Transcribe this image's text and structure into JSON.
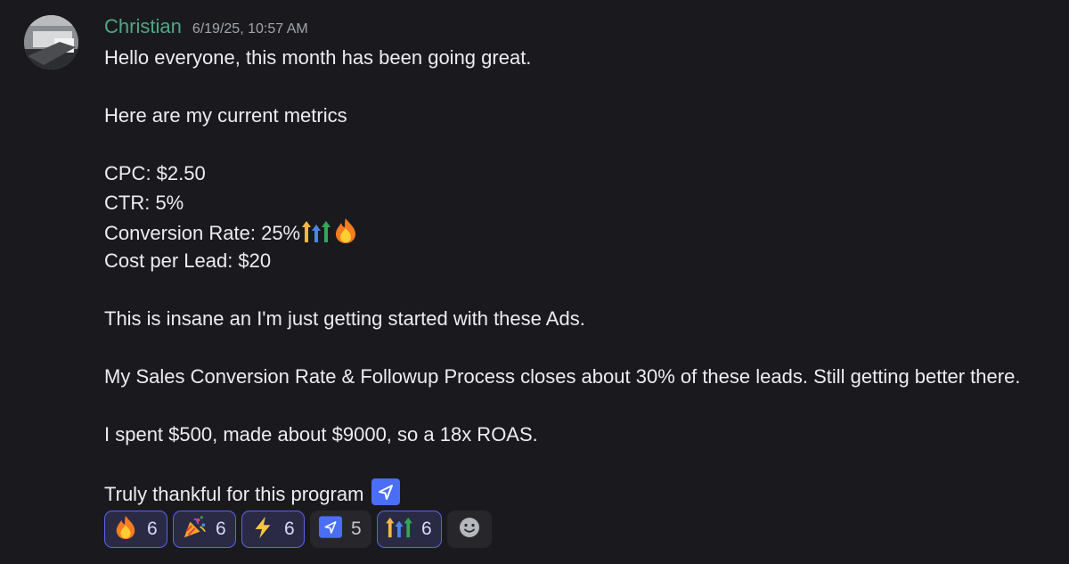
{
  "message": {
    "author": "Christian",
    "timestamp": "6/19/25, 10:57 AM",
    "lines": {
      "greeting": "Hello everyone, this month has been going great.",
      "metrics_intro": "Here are my current metrics",
      "cpc": "CPC: $2.50",
      "ctr": "CTR: 5%",
      "conversion": "Conversion Rate: 25%",
      "cost_per_lead": "Cost per Lead: $20",
      "insane": "This is insane an I'm just getting started with these Ads.",
      "sales": "My Sales Conversion Rate & Followup Process closes about 30% of these leads. Still getting better there.",
      "roas": "I spent $500, made about $9000, so a 18x ROAS.",
      "thanks": "Truly thankful for this program"
    },
    "inline_emojis": [
      "arrows-up-emoji",
      "fire-emoji",
      "send-arrow-emoji"
    ]
  },
  "reactions": [
    {
      "emoji": "fire-emoji",
      "count": "6",
      "reacted": true
    },
    {
      "emoji": "party-popper-emoji",
      "count": "6",
      "reacted": true
    },
    {
      "emoji": "lightning-emoji",
      "count": "6",
      "reacted": true
    },
    {
      "emoji": "send-arrow-emoji",
      "count": "5",
      "reacted": false
    },
    {
      "emoji": "arrows-up-emoji",
      "count": "6",
      "reacted": true
    }
  ],
  "add_reaction_icon": "smiley-icon",
  "colors": {
    "background": "#1a1a1e",
    "author": "#4fa884",
    "reacted_border": "#5a64ea",
    "reacted_fill": "#2a2a45"
  }
}
